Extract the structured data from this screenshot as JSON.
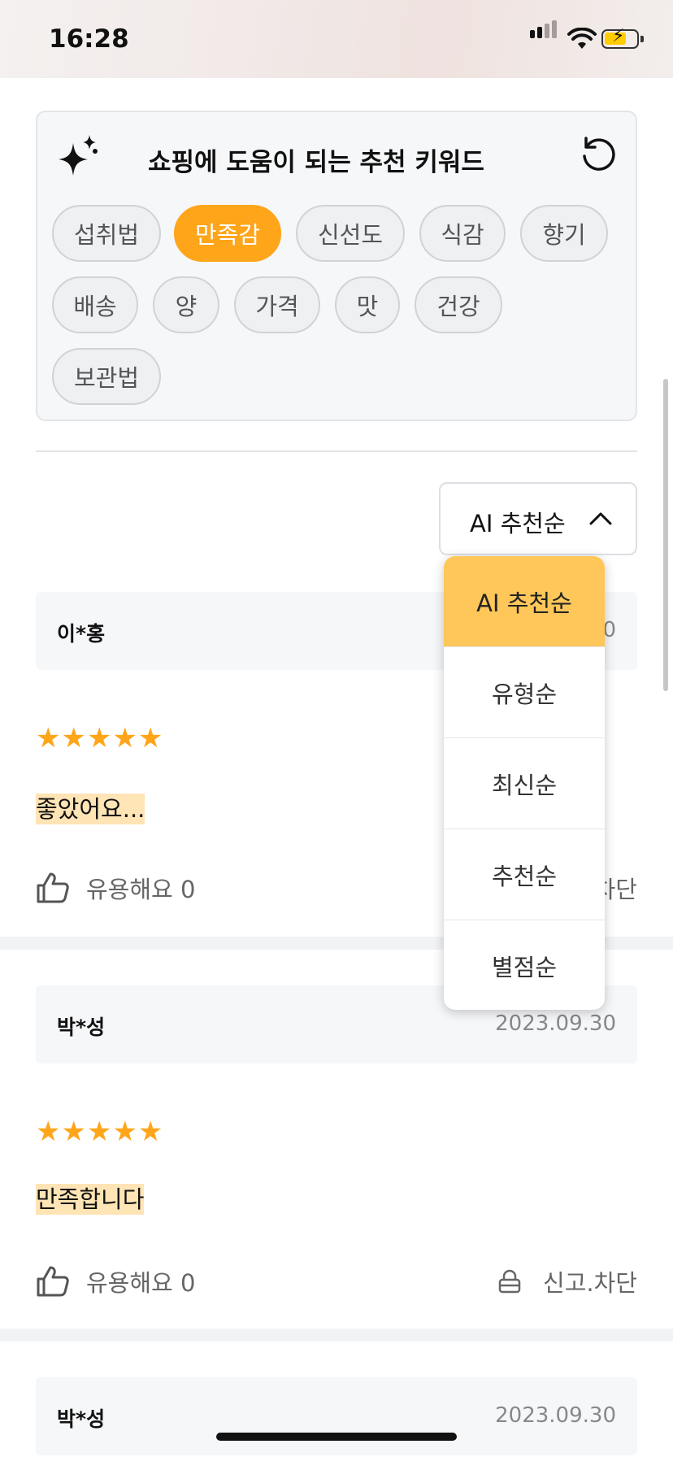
{
  "status_bar": {
    "time": "16:28"
  },
  "keywords": {
    "title": "쇼핑에 도움이 되는 추천 키워드",
    "chips": [
      "섭취법",
      "만족감",
      "신선도",
      "식감",
      "향기",
      "배송",
      "양",
      "가격",
      "맛",
      "건강",
      "보관법"
    ],
    "active": "만족감"
  },
  "sort": {
    "selected": "AI 추천순",
    "options": [
      "AI 추천순",
      "유형순",
      "최신순",
      "추천순",
      "별점순"
    ]
  },
  "reviews": [
    {
      "name": "이*홍",
      "date_visible": "0",
      "stars": "★★★★★",
      "text": "좋았어요...",
      "helpful": "유용해요 0",
      "report": "차단"
    },
    {
      "name": "박*성",
      "date": "2023.09.30",
      "stars": "★★★★★",
      "text": "만족합니다",
      "helpful": "유용해요 0",
      "report": "신고.차단"
    },
    {
      "name": "박*성",
      "date": "2023.09.30"
    }
  ],
  "colors": {
    "accent": "#ffa51a",
    "menu_selected": "#ffc65a",
    "highlight": "#ffe4b5"
  }
}
